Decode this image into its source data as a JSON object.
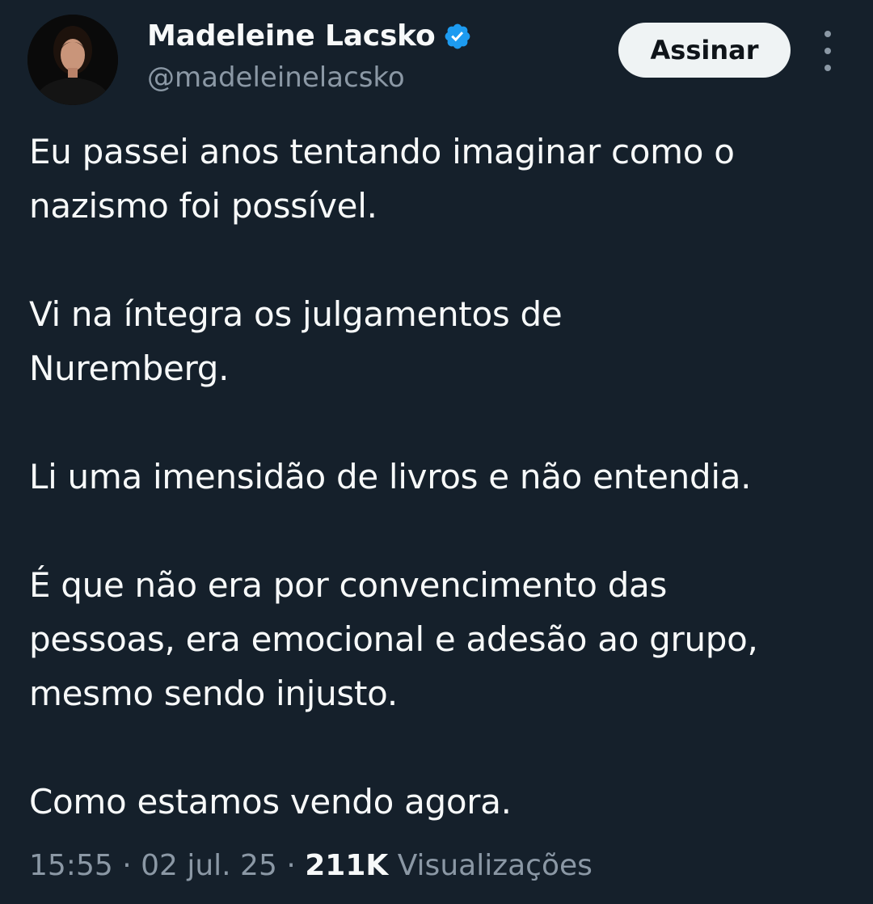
{
  "author": {
    "display_name": "Madeleine Lacsko",
    "handle": "@madeleinelacsko",
    "verified_badge_icon": "verified-badge-icon",
    "badge_color": "#1d9bf0"
  },
  "actions": {
    "follow_label": "Assinar",
    "more_icon": "more-vertical-icon"
  },
  "tweet": {
    "paragraphs": [
      [
        "Eu passei anos tentando imaginar como o",
        "nazismo foi possível."
      ],
      [
        "Vi na íntegra os julgamentos de",
        "Nuremberg."
      ],
      [
        "Li uma imensidão de livros e não entendia."
      ],
      [
        "É que não era por convencimento das",
        "pessoas, era emocional e adesão ao grupo,",
        "mesmo sendo injusto."
      ],
      [
        "Como estamos vendo agora."
      ]
    ]
  },
  "meta": {
    "time": "15:55",
    "separator": " · ",
    "date": "02 jul. 25",
    "views_count": "211K",
    "views_label": "Visualizações"
  },
  "colors": {
    "background": "#15202b",
    "primary_text": "#f7f9f9",
    "secondary_text": "#8b98a5",
    "button_bg": "#eff3f4"
  }
}
